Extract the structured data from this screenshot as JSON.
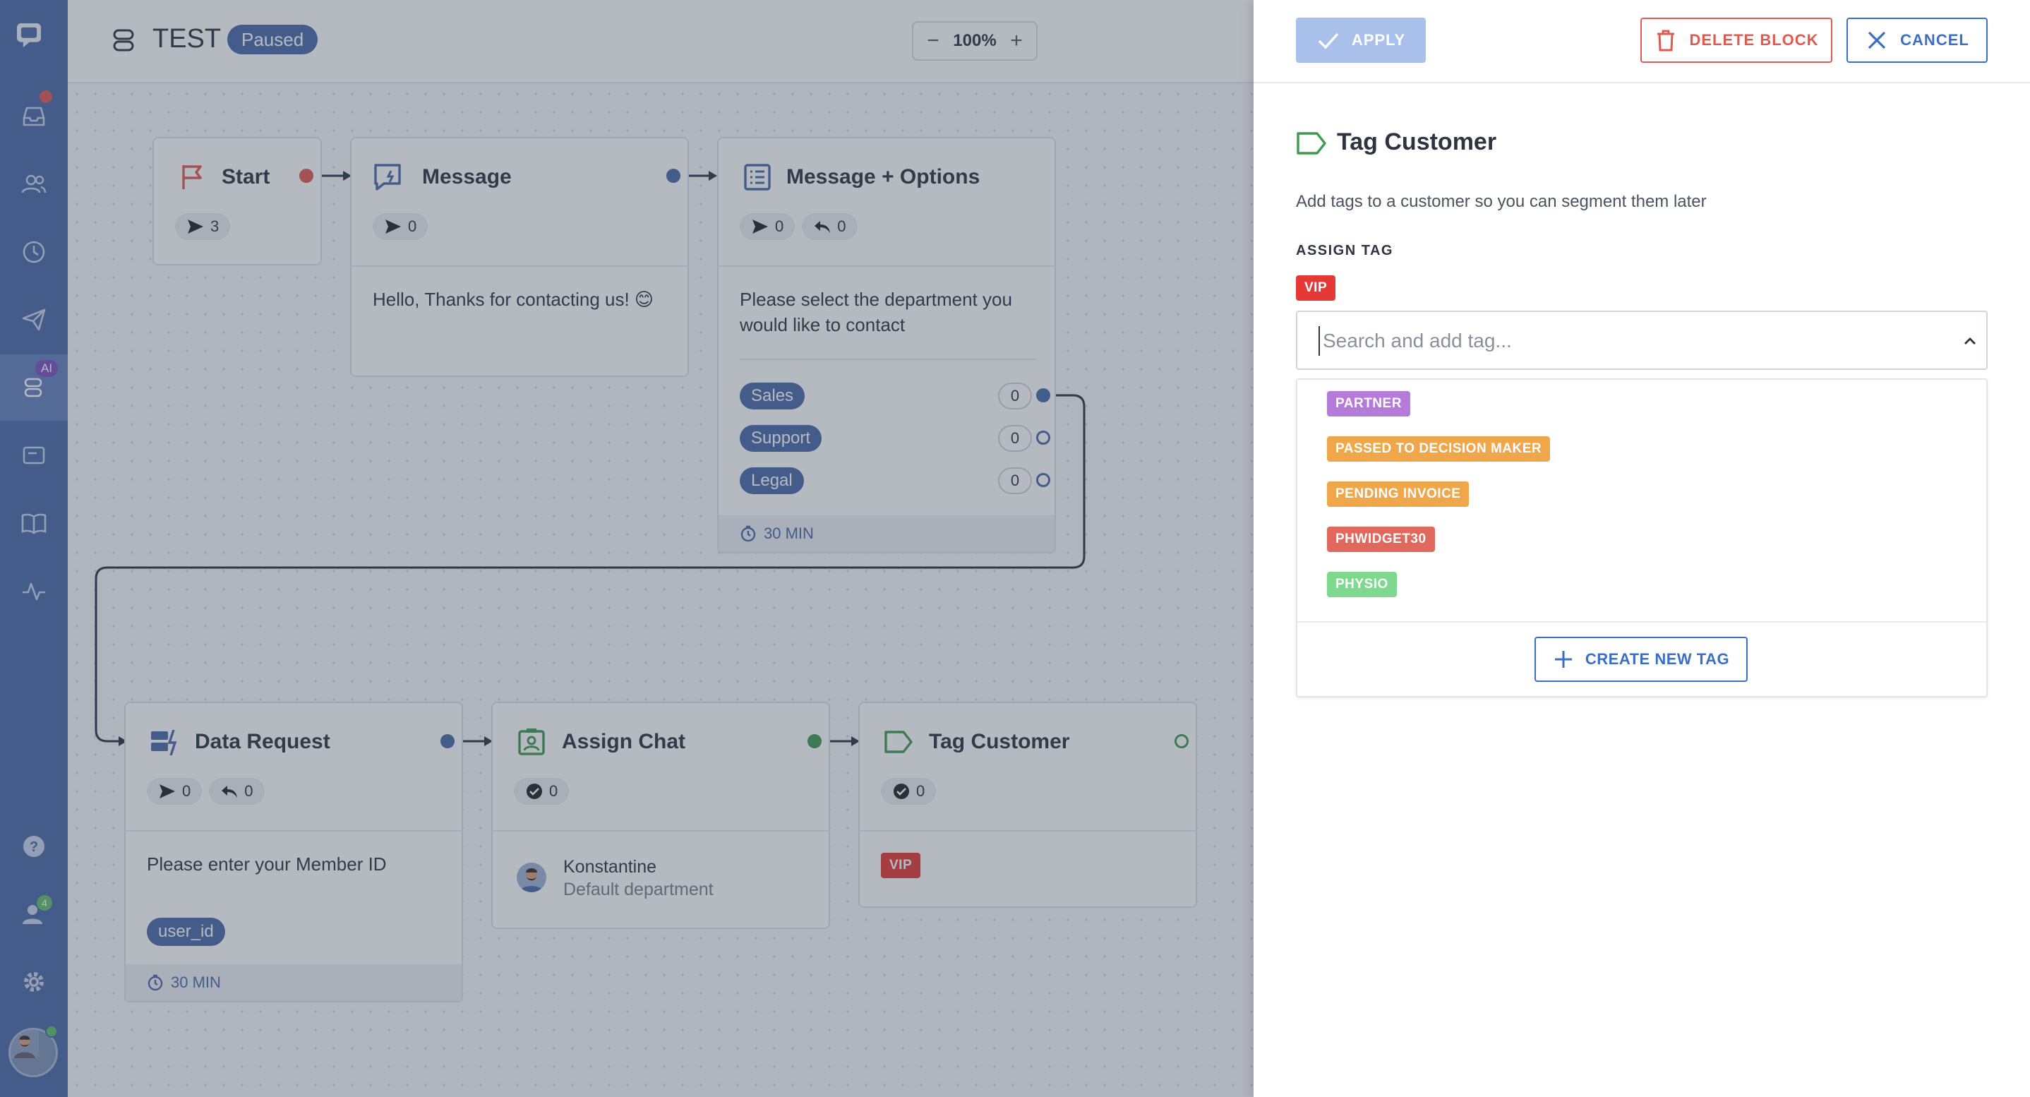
{
  "flow": {
    "title": "TEST",
    "status": "Paused",
    "zoom": "100%"
  },
  "nav": {
    "ai_badge": "AI",
    "team_count": "4"
  },
  "cards": {
    "start": {
      "title": "Start",
      "sent": "3"
    },
    "message": {
      "title": "Message",
      "sent": "0",
      "body": "Hello, Thanks for contacting us! 😊"
    },
    "options": {
      "title": "Message + Options",
      "sent": "0",
      "replied": "0",
      "body": "Please select the department you would like to contact",
      "items": [
        {
          "label": "Sales",
          "count": "0"
        },
        {
          "label": "Support",
          "count": "0"
        },
        {
          "label": "Legal",
          "count": "0"
        }
      ],
      "timer": "30 MIN"
    },
    "data_request": {
      "title": "Data Request",
      "sent": "0",
      "replied": "0",
      "body": "Please enter your Member ID",
      "variable": "user_id",
      "timer": "30 MIN"
    },
    "assign_chat": {
      "title": "Assign Chat",
      "done": "0",
      "agent_name": "Konstantine",
      "department": "Default department"
    },
    "tag_customer": {
      "title": "Tag Customer",
      "done": "0",
      "tag": "VIP"
    }
  },
  "colors": {
    "accent_blue": "#4a6aa8",
    "danger": "#e05a52",
    "success": "#3f9a4f",
    "vip": "#e53935"
  },
  "panel": {
    "apply_label": "APPLY",
    "delete_label": "DELETE BLOCK",
    "cancel_label": "CANCEL",
    "title": "Tag Customer",
    "description": "Add tags to a customer so you can segment them later",
    "assign_label": "ASSIGN TAG",
    "selected_tag": "VIP",
    "search_placeholder": "Search and add tag...",
    "tag_options": [
      {
        "label": "PARTNER",
        "color": "#b57bd8"
      },
      {
        "label": "PASSED TO DECISION MAKER",
        "color": "#f0a64a"
      },
      {
        "label": "PENDING INVOICE",
        "color": "#f0a64a"
      },
      {
        "label": "PHWIDGET30",
        "color": "#e0685c"
      },
      {
        "label": "PHYSIO",
        "color": "#7ed98e"
      }
    ],
    "create_label": "CREATE NEW TAG"
  },
  "icons": {
    "apply": "check-icon",
    "delete": "trash-icon",
    "cancel": "close-icon",
    "create": "plus-icon",
    "chevron": "chevron-up-icon",
    "tag": "tag-icon"
  }
}
